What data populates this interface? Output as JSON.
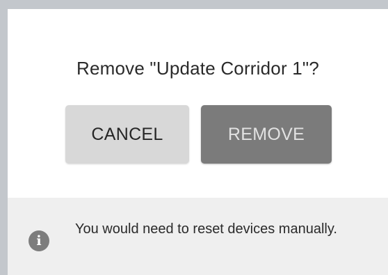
{
  "dialog": {
    "title": "Remove \"Update Corridor 1\"?",
    "cancel_label": "CANCEL",
    "remove_label": "REMOVE",
    "info": {
      "icon": "info-icon",
      "glyph": "i",
      "message": "You would need to reset devices manually."
    }
  },
  "colors": {
    "backdrop": "#c3c7cc",
    "cancel_bg": "#d8d8d8",
    "remove_bg": "#7b7b7b",
    "info_bar_bg": "#efefef"
  }
}
